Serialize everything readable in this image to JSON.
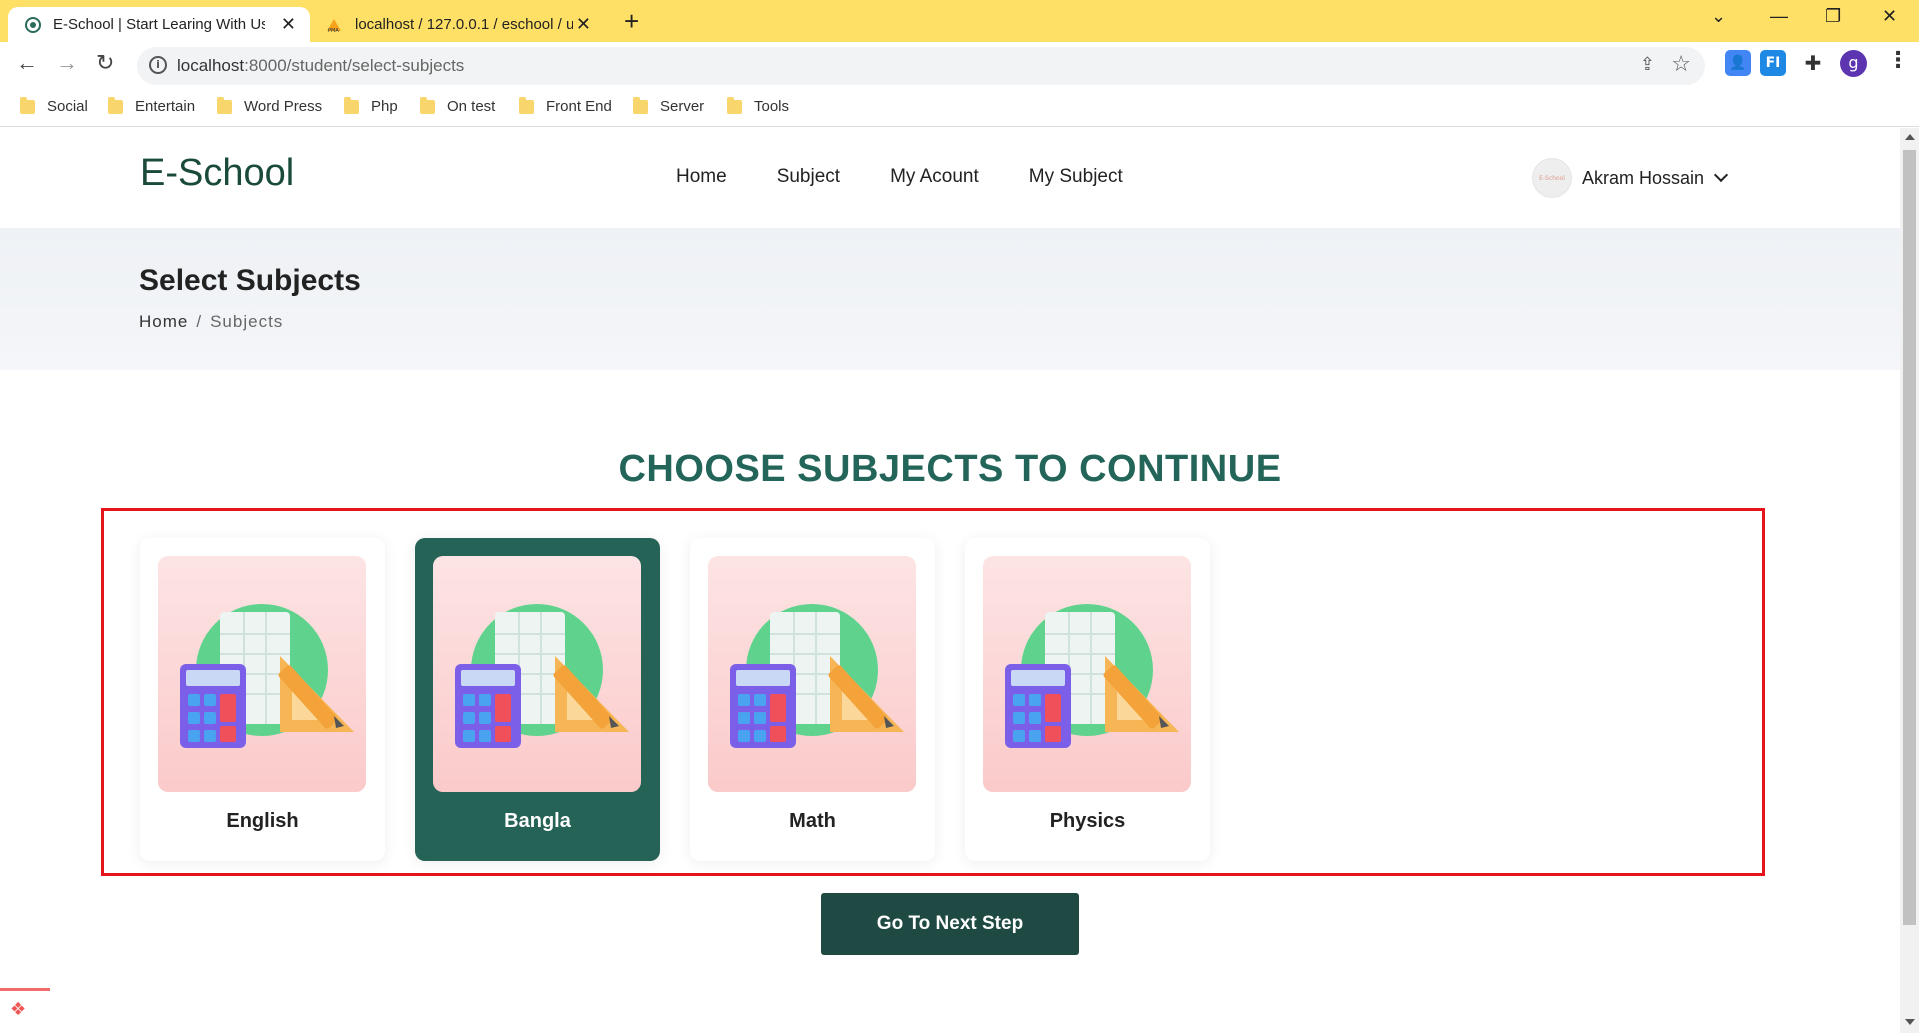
{
  "browser": {
    "tabs": [
      {
        "title": "E-School | Start Learing With Us",
        "icon": "eschool-favicon"
      },
      {
        "title": "localhost / 127.0.0.1 / eschool / u",
        "icon": "phpmyadmin-favicon"
      }
    ],
    "new_tab": "+",
    "window_controls": {
      "minimize": "—",
      "restore": "❐",
      "close": "✕",
      "tab_search": "⌄"
    },
    "url_host": "localhost",
    "url_path": ":8000/student/select-subjects",
    "extensions": [
      {
        "name": "people-extension-icon",
        "color": "#4285f4"
      },
      {
        "name": "fi-extension-icon",
        "label": "FI",
        "color": "#1e88e5"
      },
      {
        "name": "puzzle-extension-icon",
        "color": "#333333"
      }
    ],
    "profile_initial": "g",
    "bookmarks": [
      "Social",
      "Entertain",
      "Word Press",
      "Php",
      "On test",
      "Front End",
      "Server",
      "Tools"
    ]
  },
  "site": {
    "logo": "E-School",
    "nav": [
      "Home",
      "Subject",
      "My Acount",
      "My Subject"
    ],
    "user": {
      "name": "Akram Hossain",
      "avatar_text": "E-School"
    }
  },
  "hero": {
    "title": "Select Subjects",
    "breadcrumb": {
      "home": "Home",
      "separator": "/",
      "current": "Subjects"
    }
  },
  "section_title": "CHOOSE SUBJECTS TO CONTINUE",
  "subjects": [
    {
      "name": "English",
      "selected": false
    },
    {
      "name": "Bangla",
      "selected": true
    },
    {
      "name": "Math",
      "selected": false
    },
    {
      "name": "Physics",
      "selected": false
    }
  ],
  "next_button": "Go To Next Step",
  "colors": {
    "accent": "#256356",
    "heading": "#24655a",
    "button": "#1f4a43",
    "highlight_frame": "#e4141b",
    "tabbar": "#ffe066"
  }
}
